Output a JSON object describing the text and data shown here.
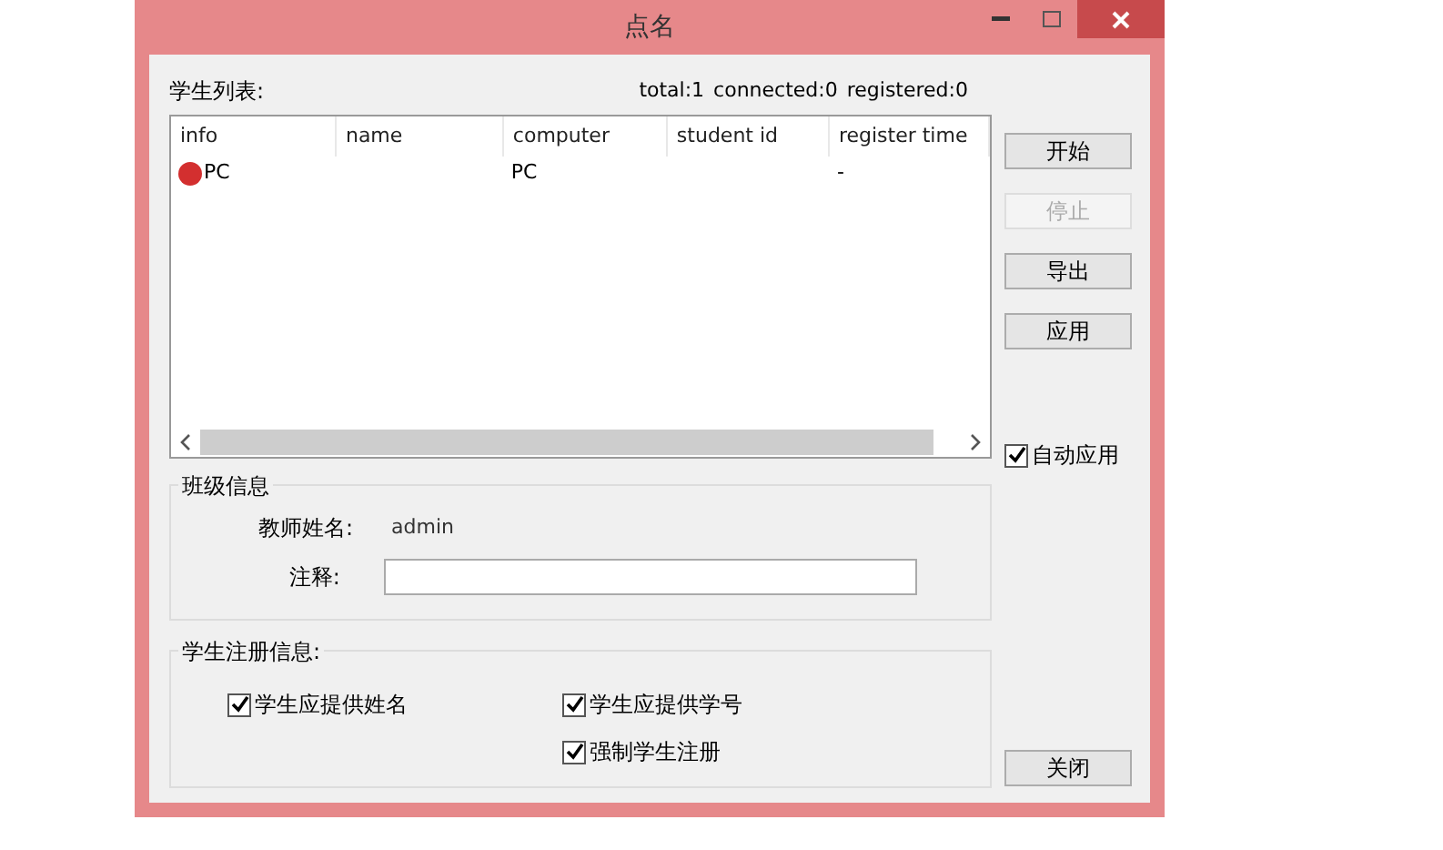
{
  "window": {
    "title": "点名"
  },
  "student_list": {
    "label": "学生列表:",
    "stats": [
      "total:1",
      "connected:0",
      "registered:0"
    ],
    "columns": [
      "info",
      "name",
      "computer",
      "student id",
      "register time"
    ],
    "rows": [
      {
        "color": "#d32f2f",
        "cells": [
          "PC",
          "",
          "PC",
          "",
          "-"
        ]
      }
    ]
  },
  "buttons": [
    {
      "label": "开始",
      "disabled": false
    },
    {
      "label": "停止",
      "disabled": true
    },
    {
      "label": "导出",
      "disabled": false
    },
    {
      "label": "应用",
      "disabled": false
    }
  ],
  "auto_apply": {
    "label": "自动应用",
    "checked": true
  },
  "class_info": {
    "title": "班级信息",
    "teacher_label": "教师姓名:",
    "teacher_value": "admin",
    "note_label": "注释:"
  },
  "registration": {
    "title": "学生注册信息:",
    "options": [
      {
        "label": "学生应提供姓名",
        "checked": true
      },
      {
        "label": "学生应提供学号",
        "checked": true
      },
      {
        "label": "强制学生注册",
        "checked": true
      }
    ]
  },
  "close_button": "关闭"
}
